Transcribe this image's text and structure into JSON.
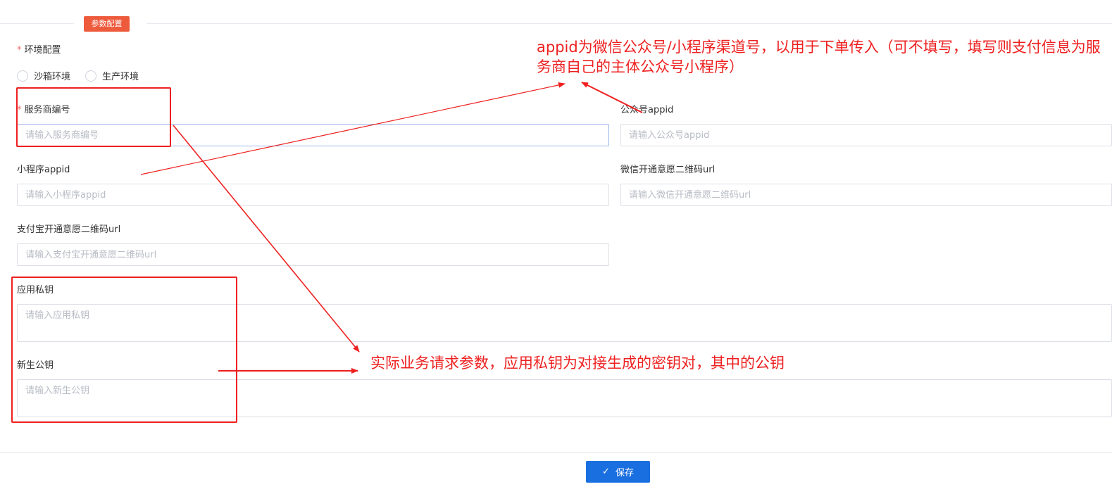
{
  "section": {
    "title": "参数配置"
  },
  "env": {
    "label": "环境配置",
    "options": [
      "沙箱环境",
      "生产环境"
    ]
  },
  "fields": {
    "service_provider_no": {
      "label": "服务商编号",
      "placeholder": "请输入服务商编号"
    },
    "official_appid": {
      "label": "公众号appid",
      "placeholder": "请输入公众号appid"
    },
    "mini_appid": {
      "label": "小程序appid",
      "placeholder": "请输入小程序appid"
    },
    "wechat_qr_url": {
      "label": "微信开通意愿二维码url",
      "placeholder": "请输入微信开通意愿二维码url"
    },
    "alipay_qr_url": {
      "label": "支付宝开通意愿二维码url",
      "placeholder": "请输入支付宝开通意愿二维码url"
    },
    "app_private_key": {
      "label": "应用私钥",
      "placeholder": "请输入应用私钥"
    },
    "new_public_key": {
      "label": "新生公钥",
      "placeholder": "请输入新生公钥"
    }
  },
  "actions": {
    "save_label": "保存"
  },
  "annotations": {
    "appid_note_line1": "appid为微信公众号/小程序渠道号，以用于下单传入（可不填写，填写则支付信息为服",
    "appid_note_line2": "务商自己的主体公众号小程序）",
    "keys_note": "实际业务请求参数，应用私钥为对接生成的密钥对，其中的公钥"
  },
  "colors": {
    "accent": "#1a6fe0",
    "tag": "#ee5a3c",
    "annotation": "#ee2020",
    "required": "#f56c6c"
  }
}
